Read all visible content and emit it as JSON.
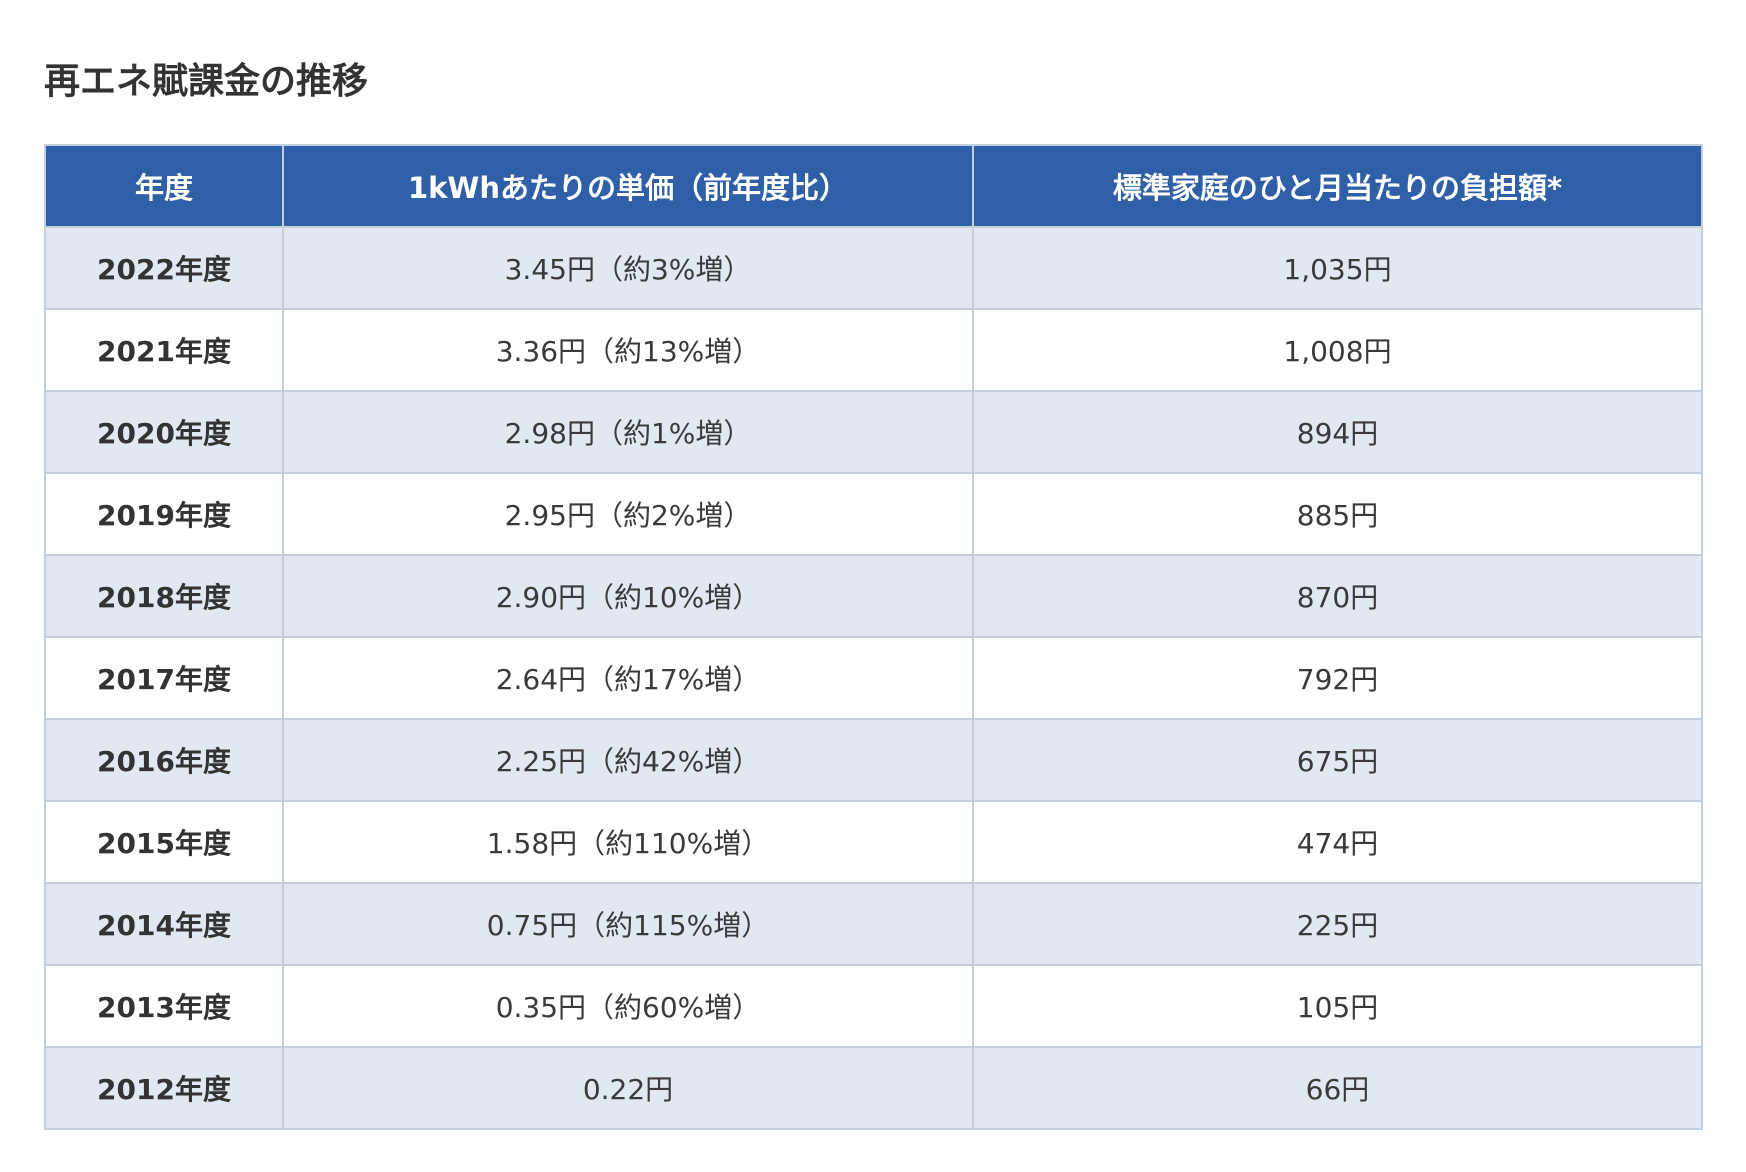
{
  "title": "再エネ賦課金の推移",
  "table": {
    "headers": [
      "年度",
      "1kWhあたりの単価（前年度比）",
      "標準家庭のひと月当たりの負担額*"
    ],
    "rows": [
      {
        "year": "2022年度",
        "unit_price": "3.45円（約3%増）",
        "monthly_burden": "1,035円"
      },
      {
        "year": "2021年度",
        "unit_price": "3.36円（約13%増）",
        "monthly_burden": "1,008円"
      },
      {
        "year": "2020年度",
        "unit_price": "2.98円（約1%増）",
        "monthly_burden": "894円"
      },
      {
        "year": "2019年度",
        "unit_price": "2.95円（約2%増）",
        "monthly_burden": "885円"
      },
      {
        "year": "2018年度",
        "unit_price": "2.90円（約10%増）",
        "monthly_burden": "870円"
      },
      {
        "year": "2017年度",
        "unit_price": "2.64円（約17%増）",
        "monthly_burden": "792円"
      },
      {
        "year": "2016年度",
        "unit_price": "2.25円（約42%増）",
        "monthly_burden": "675円"
      },
      {
        "year": "2015年度",
        "unit_price": "1.58円（約110%増）",
        "monthly_burden": "474円"
      },
      {
        "year": "2014年度",
        "unit_price": "0.75円（約115%増）",
        "monthly_burden": "225円"
      },
      {
        "year": "2013年度",
        "unit_price": "0.35円（約60%増）",
        "monthly_burden": "105円"
      },
      {
        "year": "2012年度",
        "unit_price": "0.22円",
        "monthly_burden": "66円"
      }
    ]
  },
  "colors": {
    "header_bg": "#2f5fa6",
    "stripe_bg": "#e1e8f1",
    "border": "#c5cfdb"
  }
}
